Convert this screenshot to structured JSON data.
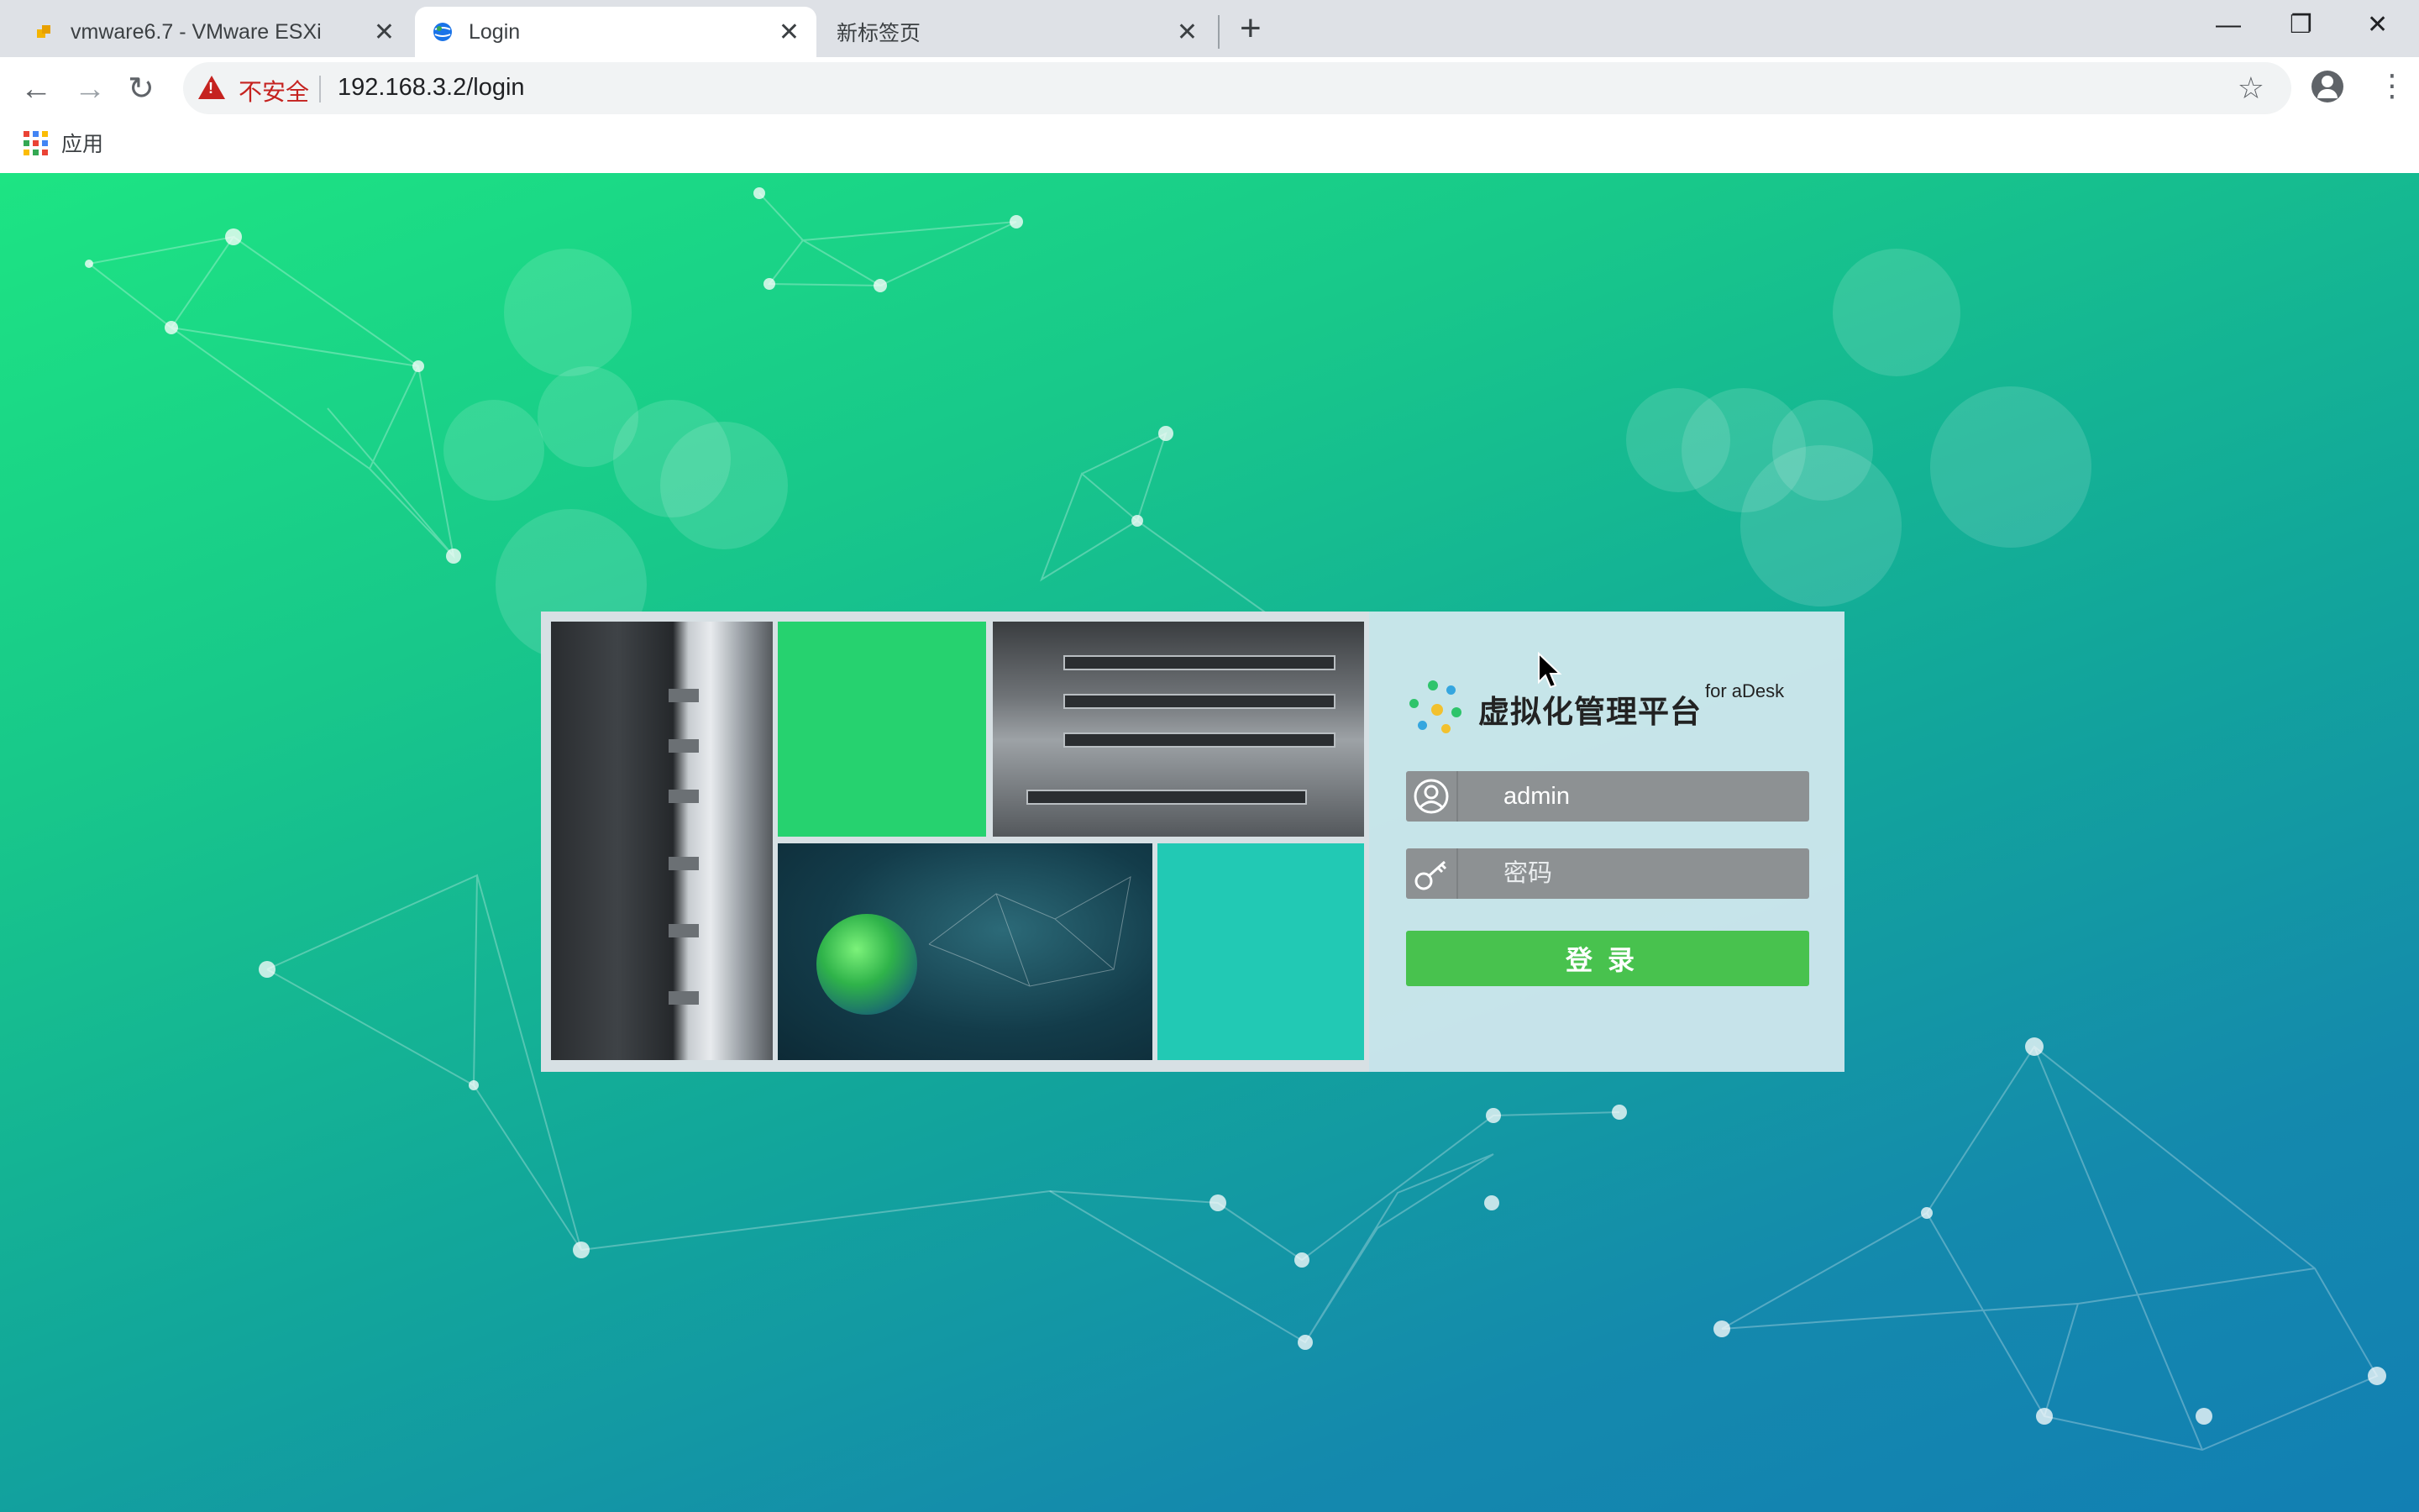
{
  "browser": {
    "tabs": [
      {
        "title": "vmware6.7 - VMware ESXi",
        "active": false,
        "favicon": "vmware-favicon"
      },
      {
        "title": "Login",
        "active": true,
        "favicon": "globe-favicon"
      },
      {
        "title": "新标签页",
        "active": false,
        "favicon": "none"
      }
    ],
    "new_tab_symbol": "+",
    "controls": {
      "minimize": "—",
      "restore": "❐",
      "close": "✕"
    },
    "nav": {
      "back": "←",
      "forward": "→",
      "reload": "↻"
    },
    "security_label": "不安全",
    "url": "192.168.3.2/login",
    "star_icon": "☆",
    "menu_icon": "⋮",
    "bookmarks": {
      "apps_label": "应用"
    }
  },
  "login": {
    "title": "虚拟化管理平台",
    "subtitle": "for aDesk",
    "username_value": "admin",
    "password_placeholder": "密码",
    "submit_label": "登录"
  },
  "colors": {
    "accent_green": "#48c24e",
    "field_grey": "#8d9193",
    "warning_red": "#c5221f"
  }
}
